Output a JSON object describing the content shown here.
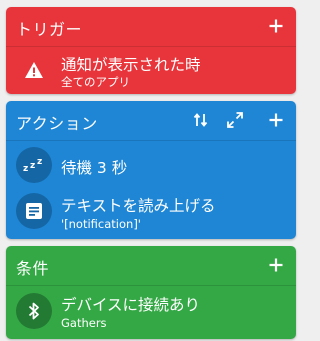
{
  "trigger": {
    "title": "トリガー",
    "color": "#e8353b",
    "items": [
      {
        "icon": "warning-icon",
        "label": "通知が表示された時",
        "sub": "全てのアプリ"
      }
    ]
  },
  "action": {
    "title": "アクション",
    "color": "#1e86d4",
    "items": [
      {
        "icon": "sleep-zzz-icon",
        "label": "待機 3 秒"
      },
      {
        "icon": "text-message-icon",
        "label": "テキストを読み上げる",
        "sub": "'[notification]'"
      }
    ]
  },
  "condition": {
    "title": "条件",
    "color": "#33a845",
    "items": [
      {
        "icon": "bluetooth-icon",
        "label": "デバイスに接続あり",
        "sub": "Gathers"
      }
    ]
  }
}
